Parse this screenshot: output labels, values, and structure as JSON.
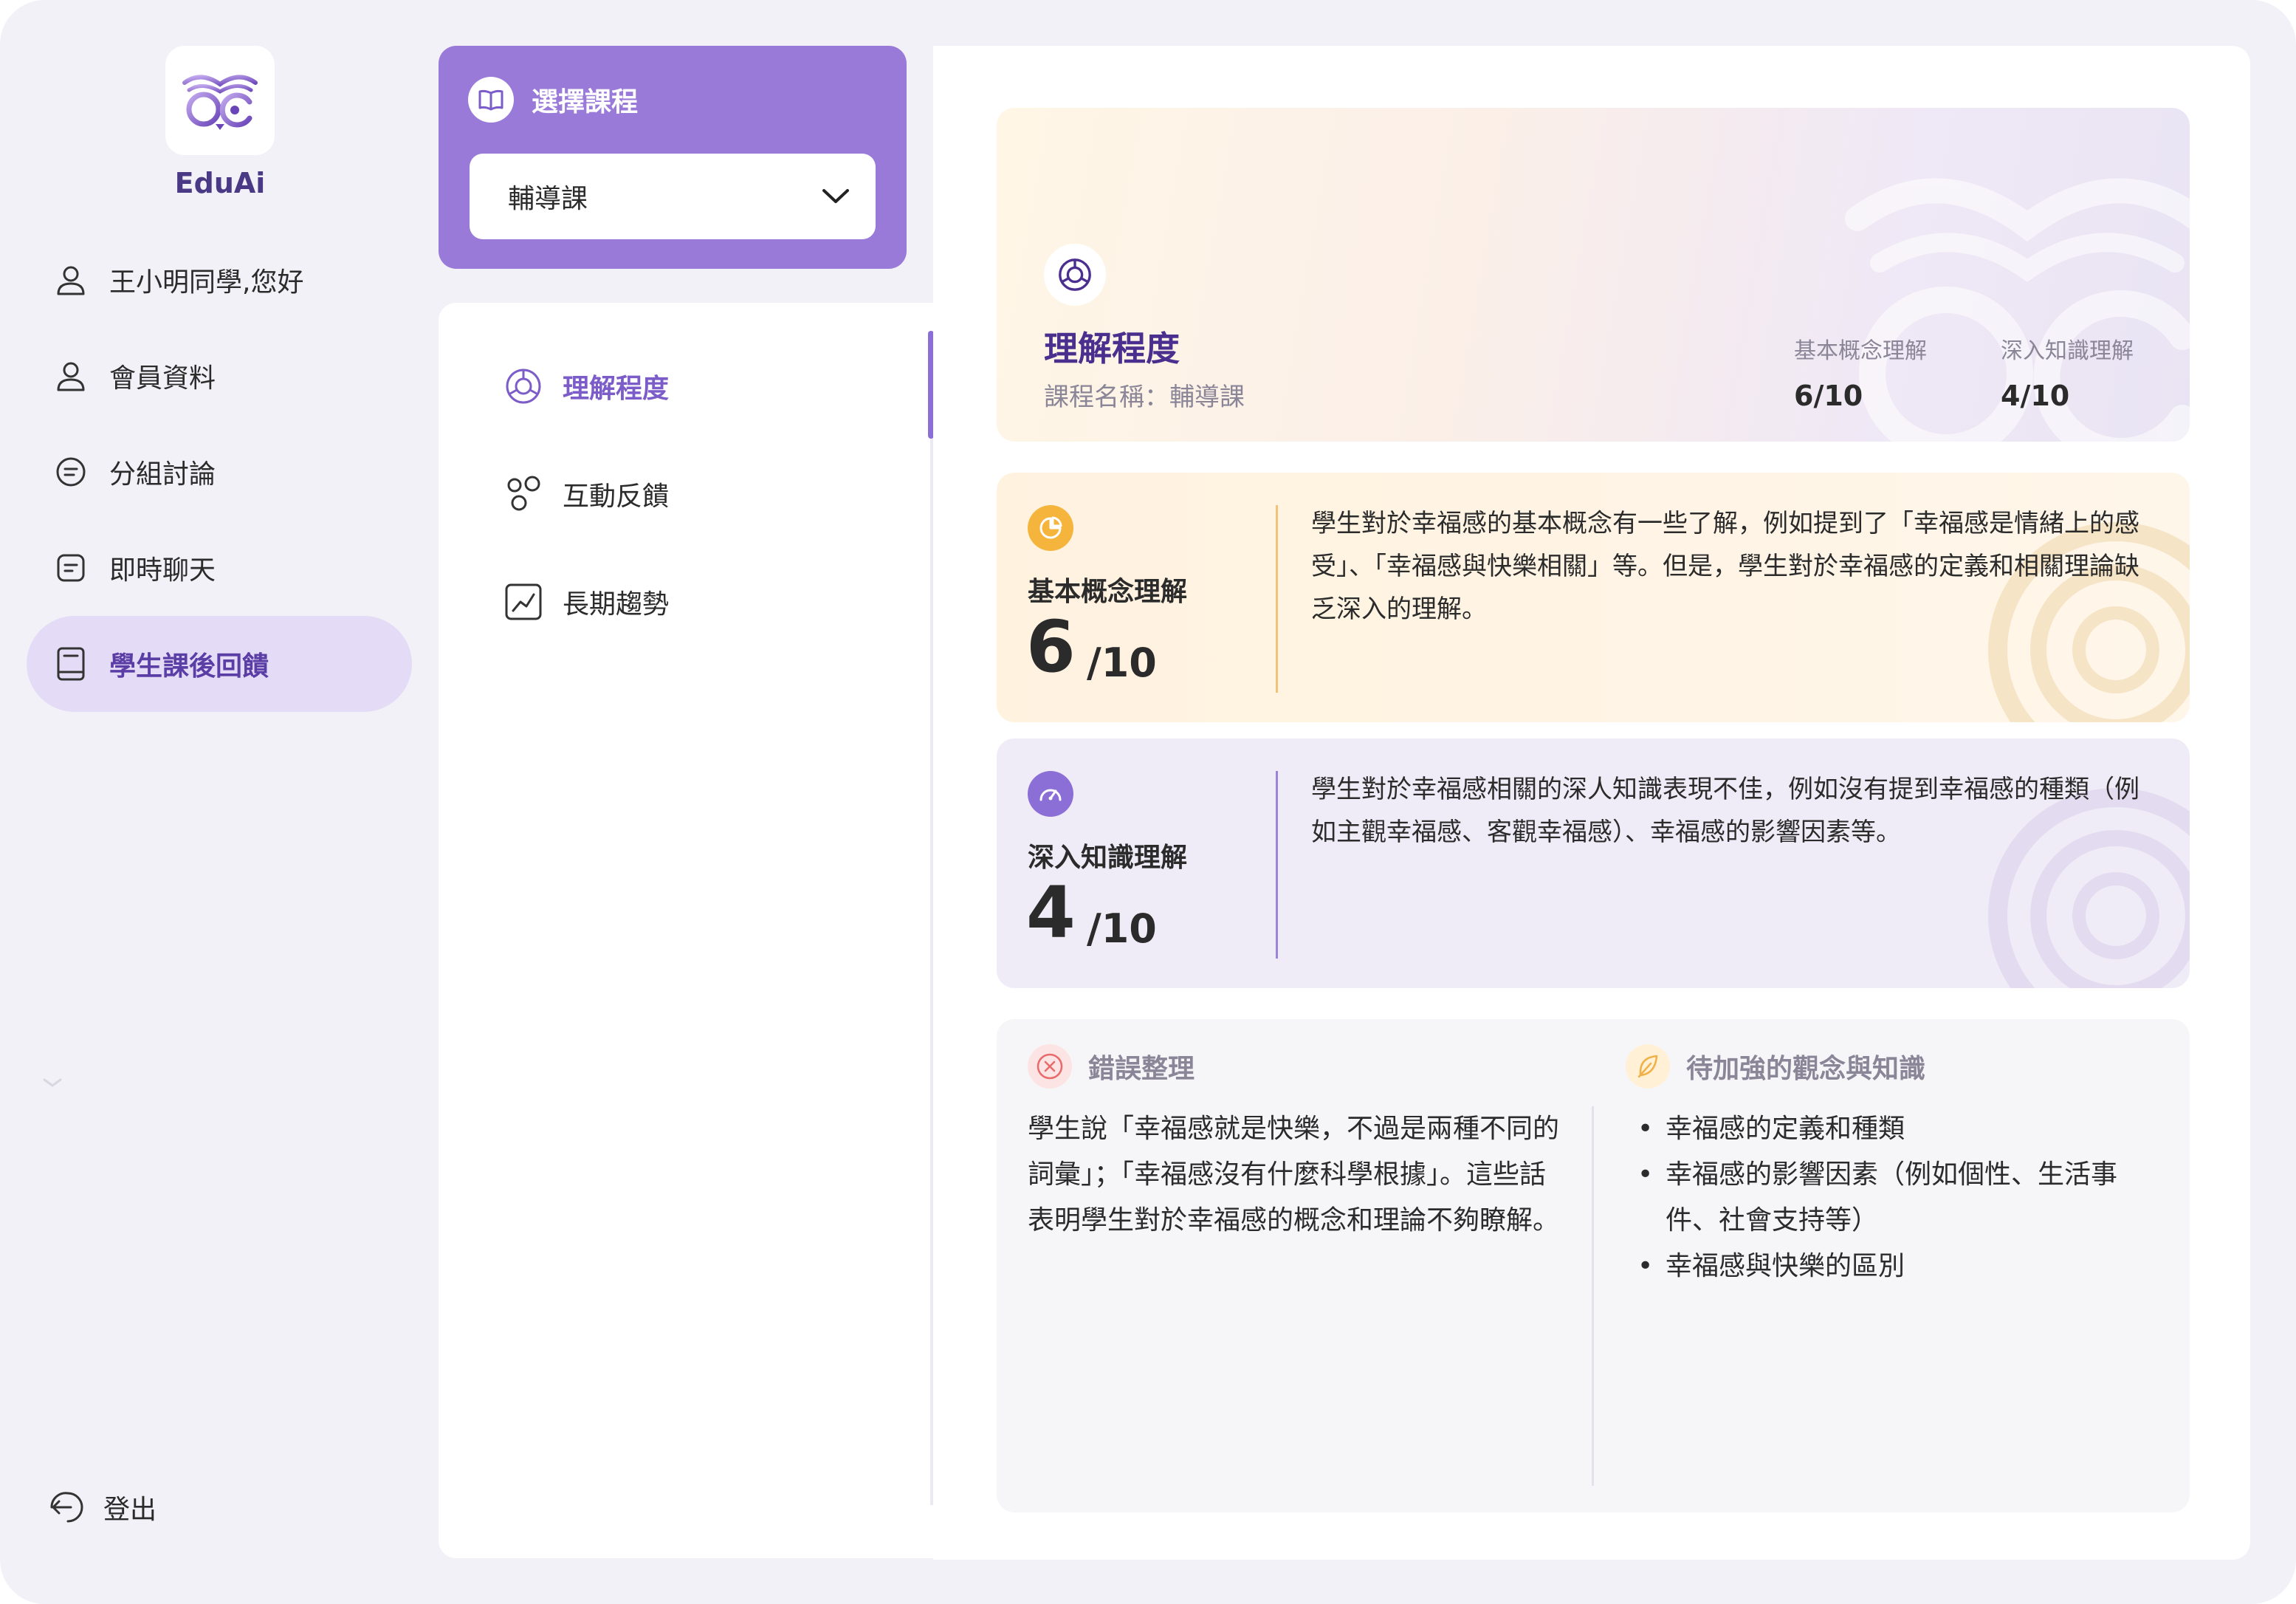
{
  "brand": {
    "name": "EduAi"
  },
  "nav": {
    "items": [
      {
        "label": "王小明同學,您好",
        "icon": "user-icon"
      },
      {
        "label": "會員資料",
        "icon": "user-icon"
      },
      {
        "label": "分組討論",
        "icon": "chat-bubble-icon"
      },
      {
        "label": "即時聊天",
        "icon": "message-square-icon"
      },
      {
        "label": "學生課後回饋",
        "icon": "book-icon",
        "active": true
      }
    ],
    "logout": "登出"
  },
  "course": {
    "heading": "選擇課程",
    "selected": "輔導課"
  },
  "submenu": {
    "items": [
      {
        "label": "理解程度",
        "icon": "chart-circle-icon",
        "active": true
      },
      {
        "label": "互動反饋",
        "icon": "bubbles-icon"
      },
      {
        "label": "長期趨勢",
        "icon": "trend-line-icon"
      }
    ]
  },
  "summary": {
    "title": "理解程度",
    "course_name": "課程名稱：輔導課",
    "basic_label": "基本概念理解",
    "basic_value": "6/10",
    "deep_label": "深入知識理解",
    "deep_value": "4/10"
  },
  "basic": {
    "label": "基本概念理解",
    "score": "6",
    "max": "/10",
    "progress": 0.6,
    "text": "學生對於幸福感的基本概念有一些了解，例如提到了「幸福感是情緒上的感受」、「幸福感與快樂相關」等。但是，學生對於幸福感的定義和相關理論缺乏深入的理解。",
    "accent": "#f5b53c"
  },
  "deep": {
    "label": "深入知識理解",
    "score": "4",
    "max": "/10",
    "progress": 0.4,
    "text": "學生對於幸福感相關的深人知識表現不佳，例如沒有提到幸福感的種類（例如主觀幸福感、客觀幸福感）、幸福感的影響因素等。",
    "accent": "#8b6fd6"
  },
  "errors": {
    "title": "錯誤整理",
    "text": "學生說「幸福感就是快樂，不過是兩種不同的詞彙」；「幸福感沒有什麼科學根據」。這些話表明學生對於幸福感的概念和理論不夠瞭解。"
  },
  "improve": {
    "title": "待加強的觀念與知識",
    "items": [
      "幸福感的定義和種類",
      "幸福感的影響因素（例如個性、生活事件、社會支持等）",
      "幸福感與快樂的區別"
    ]
  },
  "colors": {
    "primary": "#9a7ad9",
    "brand_text": "#4a3a86",
    "active_nav_bg": "#e4dcf6",
    "orange_accent": "#f5b53c",
    "purple_accent": "#8b6fd6",
    "error_red": "#e86a6a"
  }
}
